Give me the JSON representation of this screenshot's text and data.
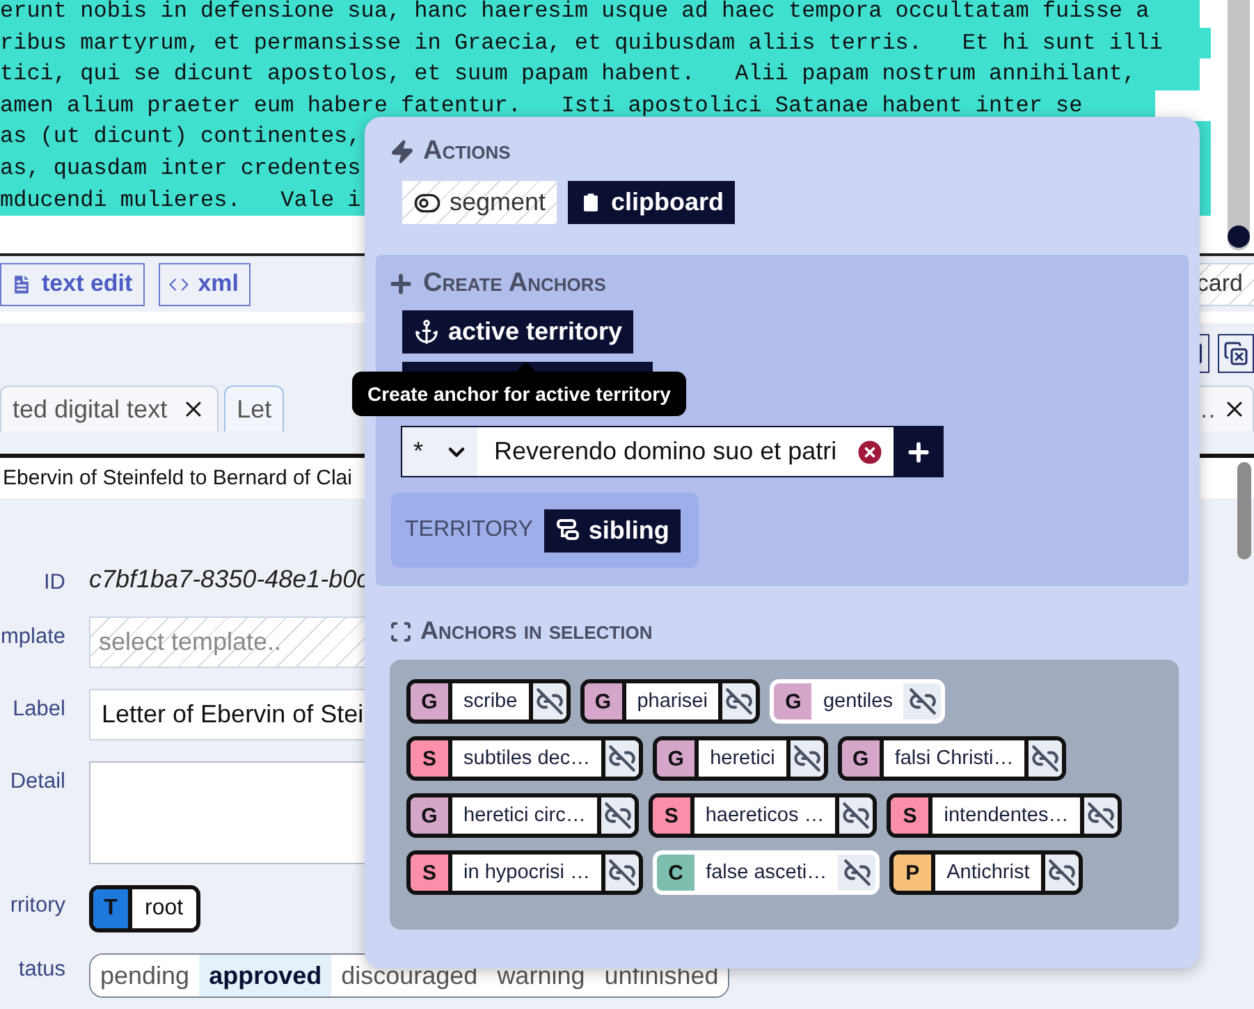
{
  "editor": {
    "lines": [
      {
        "text": "erunt nobis in defensione sua, hanc haeresim usque ad haec tempora occultatam fuisse a",
        "highlighted": true
      },
      {
        "text": "ribus martyrum, et permansisse in Graecia, et quibusdam aliis terris.   Et hi sunt illi",
        "highlighted": true
      },
      {
        "text": "tici, qui se dicunt apostolos, et suum papam habent.   Alii papam nostrum annihilant,",
        "highlighted": true
      },
      {
        "text": "amen alium praeter eum habere fatentur.   Isti apostolici Satanae habent inter se",
        "highlighted": true
      },
      {
        "text": "as (ut dicunt) continentes,",
        "highlighted": true
      },
      {
        "text": "as, quasdam inter credentes",
        "highlighted": true
      },
      {
        "text": "mducendi mulieres.   Vale i",
        "highlighted": true
      }
    ]
  },
  "toolbar": {
    "buttons": [
      {
        "label": "text edit",
        "kind": "doc"
      },
      {
        "label": "xml",
        "kind": "code"
      }
    ],
    "right_button": {
      "label": "card"
    }
  },
  "tabs": [
    {
      "label": "ted digital text",
      "selected": false
    },
    {
      "label": "Let",
      "selected": true
    },
    {
      "label": "…",
      "selected": false
    }
  ],
  "document_title": "Ebervin of Steinfeld to Bernard of Clai",
  "form": [
    {
      "label": "ID",
      "kind": "id",
      "value": "c7bf1ba7-8350-48e1-b0c"
    },
    {
      "label": "mplate",
      "kind": "select",
      "placeholder": "select template.."
    },
    {
      "label": "Label",
      "kind": "text",
      "value": "Letter of Ebervin of Stei"
    },
    {
      "label": "Detail",
      "kind": "textarea"
    },
    {
      "label": "rritory",
      "kind": "territory",
      "letter": "T",
      "value": "root",
      "color": "#1f78dc"
    },
    {
      "label": "tatus",
      "kind": "status",
      "options": [
        {
          "label": "pending",
          "selected": false
        },
        {
          "label": "approved",
          "selected": true
        },
        {
          "label": "discouraged",
          "selected": false
        },
        {
          "label": "warning",
          "selected": false
        },
        {
          "label": "unfinished",
          "selected": false
        }
      ]
    }
  ],
  "popup": {
    "actions": {
      "title": "Actions",
      "buttons": [
        {
          "label": "segment",
          "disabled": true
        },
        {
          "label": "clipboard",
          "disabled": false
        }
      ]
    },
    "create": {
      "title": "Create Anchors",
      "button": "active territory",
      "tooltip": "Create anchor for active territory",
      "select_value": "*",
      "input_value": "Reverendo domino suo et patri",
      "territory_label": "TERRITORY",
      "territory_button": "sibling"
    },
    "anchors_title": "Anchors in selection",
    "anchors": [
      {
        "letter": "G",
        "label": "scribe",
        "color": "#d5a6ca",
        "selected": true
      },
      {
        "letter": "G",
        "label": "pharisei",
        "color": "#d5a6ca",
        "selected": true
      },
      {
        "letter": "G",
        "label": "gentiles",
        "color": "#d5a6ca",
        "selected": false
      },
      {
        "letter": "S",
        "label": "subtiles dec…",
        "color": "#fb8ea8",
        "selected": true
      },
      {
        "letter": "G",
        "label": "heretici",
        "color": "#d5a6ca",
        "selected": true
      },
      {
        "letter": "G",
        "label": "falsi Christi…",
        "color": "#d5a6ca",
        "selected": true
      },
      {
        "letter": "G",
        "label": "heretici circ…",
        "color": "#d5a6ca",
        "selected": true
      },
      {
        "letter": "S",
        "label": "haereticos …",
        "color": "#fb8ea8",
        "selected": true
      },
      {
        "letter": "S",
        "label": "intendentes…",
        "color": "#fb8ea8",
        "selected": true
      },
      {
        "letter": "S",
        "label": "in hypocrisi …",
        "color": "#fb8ea8",
        "selected": true
      },
      {
        "letter": "C",
        "label": "false asceti…",
        "color": "#7dbfae",
        "selected": false
      },
      {
        "letter": "P",
        "label": "Antichrist",
        "color": "#f7c07b",
        "selected": true
      }
    ]
  }
}
